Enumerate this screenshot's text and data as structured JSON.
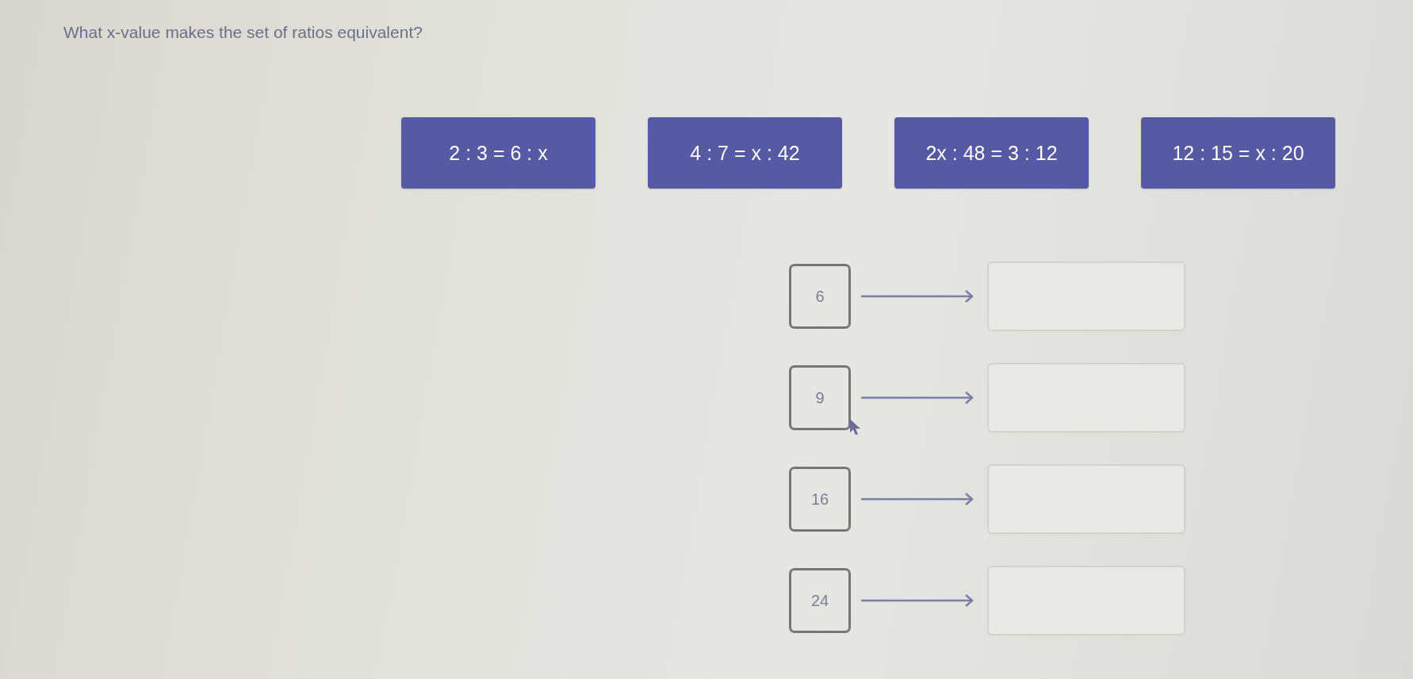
{
  "question": "What x-value makes the set of ratios equivalent?",
  "tiles": [
    {
      "text": "2 : 3 = 6 : x"
    },
    {
      "text": "4 : 7 = x : 42"
    },
    {
      "text": "2x : 48 = 3 : 12"
    },
    {
      "text": "12 : 15 = x : 20"
    }
  ],
  "matches": [
    {
      "value": "6",
      "cursor": false
    },
    {
      "value": "9",
      "cursor": true
    },
    {
      "value": "16",
      "cursor": false
    },
    {
      "value": "24",
      "cursor": false
    }
  ]
}
